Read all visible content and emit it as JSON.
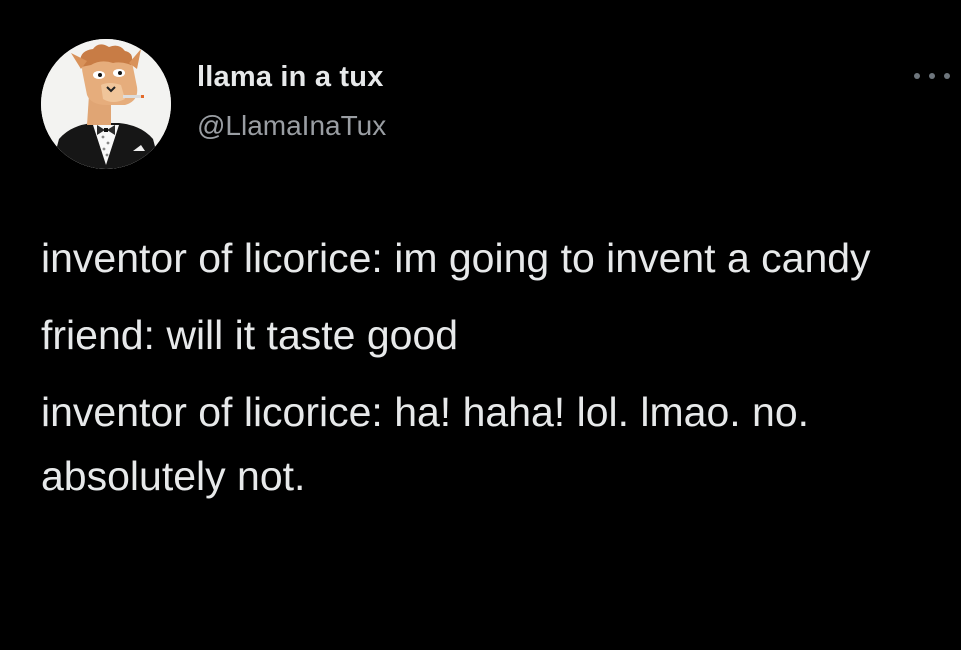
{
  "tweet": {
    "display_name": "llama in a tux",
    "handle": "@LlamaInaTux",
    "more_icon": "ellipsis-icon",
    "avatar_icon": "llama-in-tuxedo-avatar",
    "paragraphs": [
      "inventor of licorice: im going to invent a candy",
      "friend: will it taste good",
      "inventor of licorice: ha! haha! lol. lmao. no. absolutely not."
    ]
  },
  "colors": {
    "background": "#000000",
    "text_primary": "#e7e9ea",
    "text_secondary": "#9a9ea3"
  }
}
